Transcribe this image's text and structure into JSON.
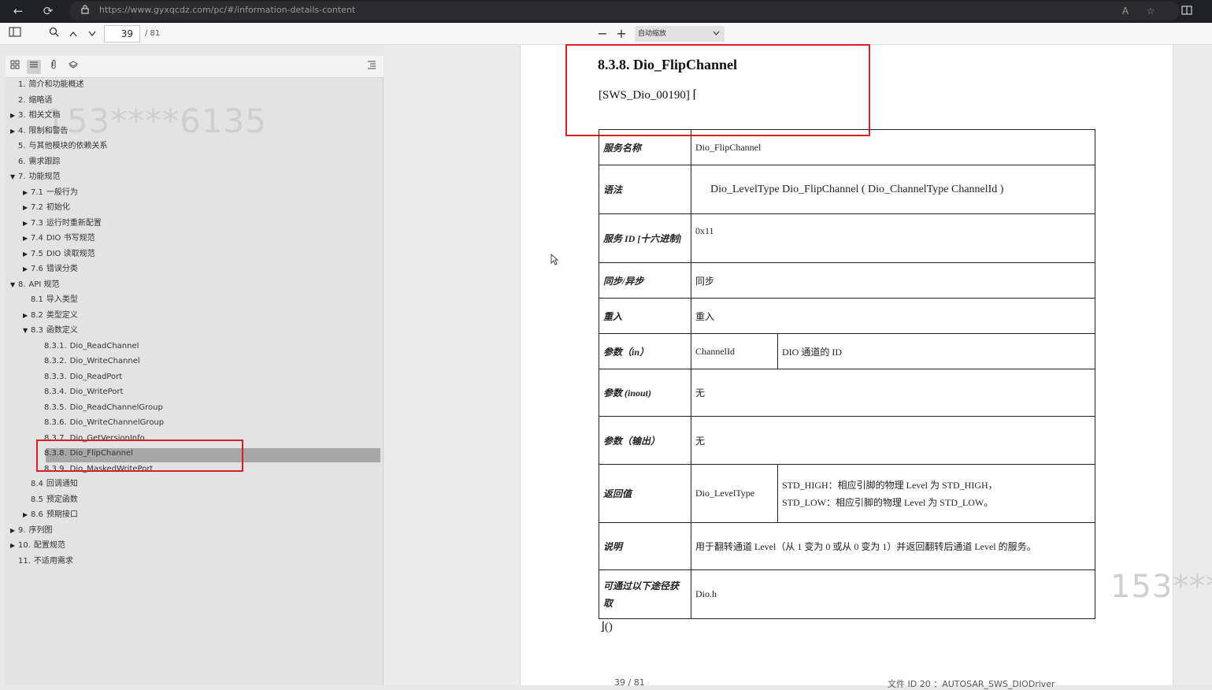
{
  "browser": {
    "url": "https://www.gyxqcdz.com/pc/#/information-details-content",
    "back": "←",
    "reload": "⟳"
  },
  "toolbar": {
    "page_current": "39",
    "page_total": "/ 81",
    "zoom_minus": "−",
    "zoom_plus": "+",
    "zoom_label": "自动缩放"
  },
  "sidebar": {
    "watermark": "153****6135",
    "items": [
      {
        "num": "1.",
        "label": "简介和功能概述",
        "level": 0,
        "toggle": ""
      },
      {
        "num": "2.",
        "label": "缩略语",
        "level": 0,
        "toggle": ""
      },
      {
        "num": "3.",
        "label": "相关文档",
        "level": 0,
        "toggle": "▶"
      },
      {
        "num": "4.",
        "label": "限制和警告",
        "level": 0,
        "toggle": "▶"
      },
      {
        "num": "5.",
        "label": "与其他模块的依赖关系",
        "level": 0,
        "toggle": ""
      },
      {
        "num": "6.",
        "label": "需求跟踪",
        "level": 0,
        "toggle": ""
      },
      {
        "num": "7.",
        "label": "功能规范",
        "level": 0,
        "toggle": "▼"
      },
      {
        "num": "7.1",
        "label": "一般行为",
        "level": 1,
        "toggle": "▶"
      },
      {
        "num": "7.2",
        "label": "初始化",
        "level": 1,
        "toggle": "▶"
      },
      {
        "num": "7.3",
        "label": "运行时重新配置",
        "level": 1,
        "toggle": "▶"
      },
      {
        "num": "7.4",
        "label": "DIO 书写规范",
        "level": 1,
        "toggle": "▶"
      },
      {
        "num": "7.5",
        "label": "DIO 读取规范",
        "level": 1,
        "toggle": "▶"
      },
      {
        "num": "7.6",
        "label": "错误分类",
        "level": 1,
        "toggle": "▶"
      },
      {
        "num": "8.",
        "label": "API 规范",
        "level": 0,
        "toggle": "▼"
      },
      {
        "num": "8.1",
        "label": "导入类型",
        "level": 1,
        "toggle": ""
      },
      {
        "num": "8.2",
        "label": "类型定义",
        "level": 1,
        "toggle": "▶"
      },
      {
        "num": "8.3",
        "label": "函数定义",
        "level": 1,
        "toggle": "▼"
      },
      {
        "num": "8.3.1.",
        "label": "Dio_ReadChannel",
        "level": 2,
        "toggle": ""
      },
      {
        "num": "8.3.2.",
        "label": "Dio_WriteChannel",
        "level": 2,
        "toggle": ""
      },
      {
        "num": "8.3.3.",
        "label": "Dio_ReadPort",
        "level": 2,
        "toggle": ""
      },
      {
        "num": "8.3.4.",
        "label": "Dio_WritePort",
        "level": 2,
        "toggle": ""
      },
      {
        "num": "8.3.5.",
        "label": "Dio_ReadChannelGroup",
        "level": 2,
        "toggle": ""
      },
      {
        "num": "8.3.6.",
        "label": "Dio_WriteChannelGroup",
        "level": 2,
        "toggle": ""
      },
      {
        "num": "8.3.7.",
        "label": "Dio_GetVersionInfo",
        "level": 2,
        "toggle": ""
      },
      {
        "num": "8.3.8.",
        "label": "Dio_FlipChannel",
        "level": 2,
        "toggle": ""
      },
      {
        "num": "8.3.9.",
        "label": "Dio_MaskedWritePort",
        "level": 2,
        "toggle": ""
      },
      {
        "num": "8.4",
        "label": "回调通知",
        "level": 1,
        "toggle": ""
      },
      {
        "num": "8.5",
        "label": "预定函数",
        "level": 1,
        "toggle": ""
      },
      {
        "num": "8.6",
        "label": "预期接口",
        "level": 1,
        "toggle": "▶"
      },
      {
        "num": "9.",
        "label": "序列图",
        "level": 0,
        "toggle": "▶"
      },
      {
        "num": "10.",
        "label": "配置规范",
        "level": 0,
        "toggle": "▶"
      },
      {
        "num": "11.",
        "label": "不适用需求",
        "level": 0,
        "toggle": ""
      }
    ]
  },
  "document": {
    "section_title": "8.3.8. Dio_FlipChannel",
    "requirement": "[SWS_Dio_00190] ⌈",
    "watermark": "153***",
    "end_mark": "⌋()",
    "footer_left": "39 / 81",
    "footer_right": "文件 ID 20 ：AUTOSAR_SWS_DIODriver",
    "table": {
      "service_name_label": "服务名称",
      "service_name": "Dio_FlipChannel",
      "syntax_label": "语法",
      "syntax": "Dio_LevelType Dio_FlipChannel ( Dio_ChannelType ChannelId )",
      "service_id_label": "服务 ID [十六进制]",
      "service_id": "0x11",
      "sync_label": "同步/异步",
      "sync": "同步",
      "reentrancy_label": "重入",
      "reentrancy": "重入",
      "param_in_label": "参数（in）",
      "param_in_name": "ChannelId",
      "param_in_desc": "DIO 通道的 ID",
      "param_inout_label": "参数 (inout)",
      "param_inout": "无",
      "param_out_label": "参数（输出）",
      "param_out": "无",
      "return_label": "返回值",
      "return_type": "Dio_LevelType",
      "return_desc_1": "STD_HIGH：相应引脚的物理 Level 为 STD_HIGH，",
      "return_desc_2": "STD_LOW：相应引脚的物理 Level 为 STD_LOW。",
      "description_label": "说明",
      "description": "用于翻转通道 Level（从 1 变为 0 或从 0 变为 1）并返回翻转后通道 Level 的服务。",
      "available_label": "可通过以下途径获取",
      "available": "Dio.h"
    }
  }
}
